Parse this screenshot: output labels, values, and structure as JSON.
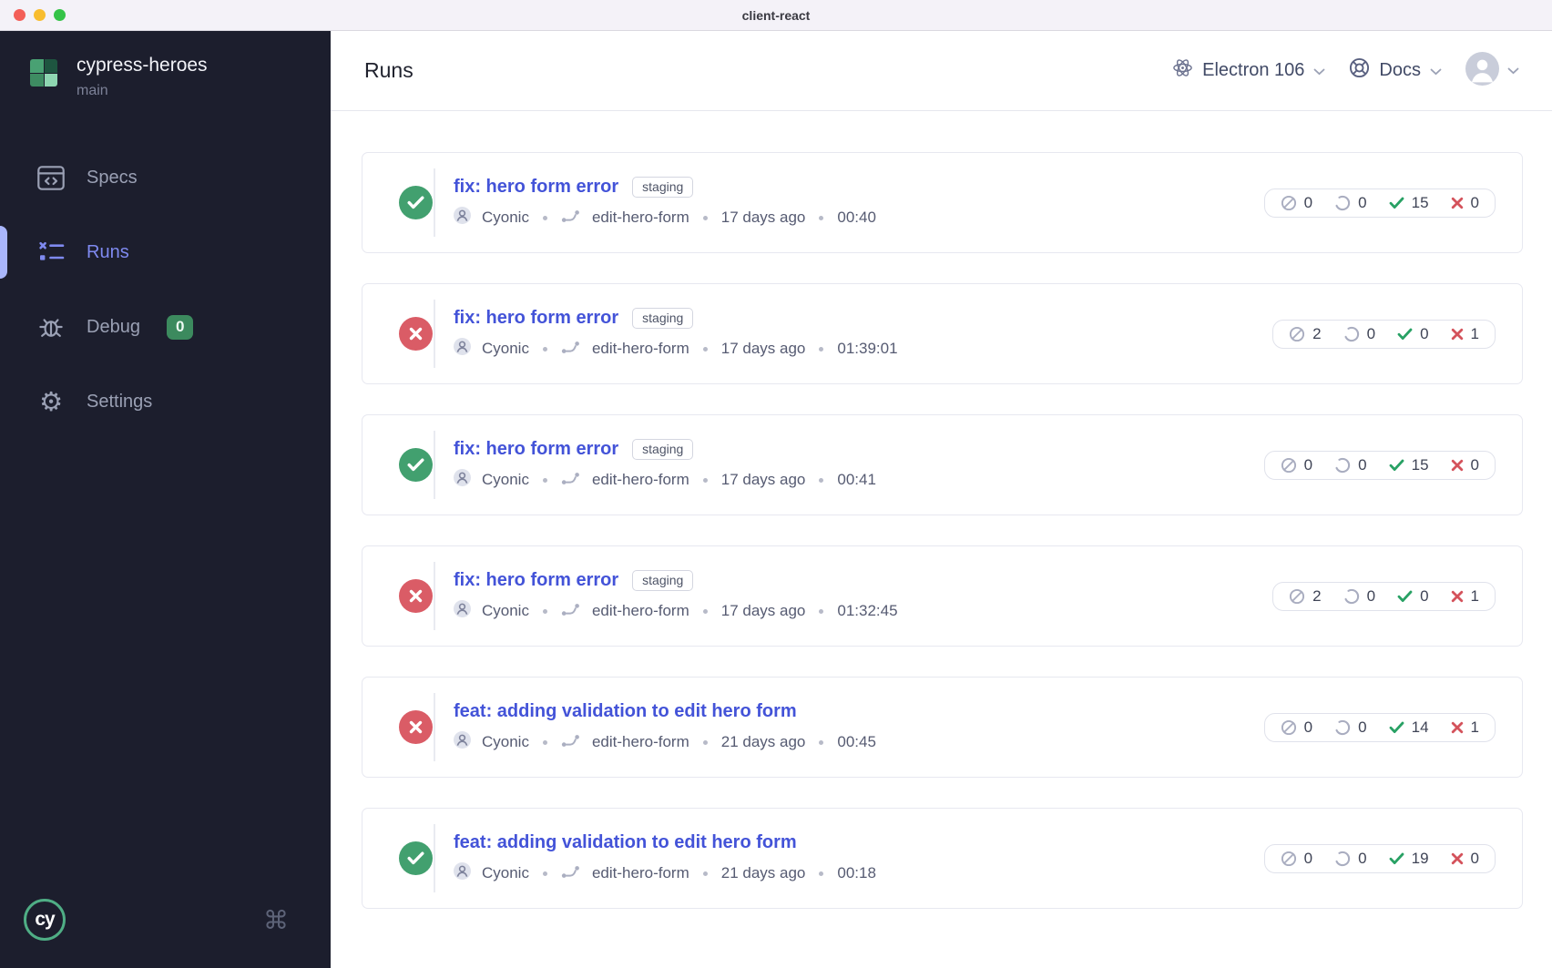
{
  "window": {
    "title": "client-react"
  },
  "sidebar": {
    "project": {
      "name": "cypress-heroes",
      "branch": "main"
    },
    "items": [
      {
        "label": "Specs"
      },
      {
        "label": "Runs"
      },
      {
        "label": "Debug",
        "badge": "0"
      },
      {
        "label": "Settings"
      }
    ],
    "footer": {
      "logo_text": "cy"
    }
  },
  "header": {
    "title": "Runs",
    "browser_label": "Electron 106",
    "docs_label": "Docs"
  },
  "runs": [
    {
      "status": "passed",
      "title": "fix: hero form error",
      "tag": "staging",
      "author": "Cyonic",
      "branch": "edit-hero-form",
      "age": "17 days ago",
      "duration": "00:40",
      "skipped": 0,
      "pending": 0,
      "passed": 15,
      "failed": 0
    },
    {
      "status": "failed",
      "title": "fix: hero form error",
      "tag": "staging",
      "author": "Cyonic",
      "branch": "edit-hero-form",
      "age": "17 days ago",
      "duration": "01:39:01",
      "skipped": 2,
      "pending": 0,
      "passed": 0,
      "failed": 1
    },
    {
      "status": "passed",
      "title": "fix: hero form error",
      "tag": "staging",
      "author": "Cyonic",
      "branch": "edit-hero-form",
      "age": "17 days ago",
      "duration": "00:41",
      "skipped": 0,
      "pending": 0,
      "passed": 15,
      "failed": 0
    },
    {
      "status": "failed",
      "title": "fix: hero form error",
      "tag": "staging",
      "author": "Cyonic",
      "branch": "edit-hero-form",
      "age": "17 days ago",
      "duration": "01:32:45",
      "skipped": 2,
      "pending": 0,
      "passed": 0,
      "failed": 1
    },
    {
      "status": "failed",
      "title": "feat: adding validation to edit hero form",
      "tag": null,
      "author": "Cyonic",
      "branch": "edit-hero-form",
      "age": "21 days ago",
      "duration": "00:45",
      "skipped": 0,
      "pending": 0,
      "passed": 14,
      "failed": 1
    },
    {
      "status": "passed",
      "title": "feat: adding validation to edit hero form",
      "tag": null,
      "author": "Cyonic",
      "branch": "edit-hero-form",
      "age": "21 days ago",
      "duration": "00:18",
      "skipped": 0,
      "pending": 0,
      "passed": 19,
      "failed": 0
    }
  ],
  "colors": {
    "accent_indigo": "#4353d8",
    "passed_green": "#42a06f",
    "failed_red": "#da5c66",
    "badge_green": "#3c8a5e",
    "sidebar_bg": "#1c1e2d"
  }
}
